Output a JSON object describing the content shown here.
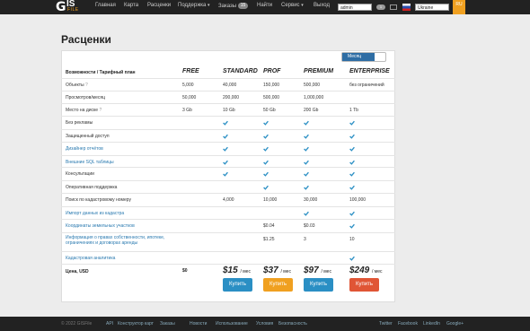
{
  "brand": {
    "logo_g": "G",
    "logo_is": "IS",
    "logo_file": "FILE"
  },
  "nav": {
    "home": "Главная",
    "map": "Карта",
    "prices": "Расценки",
    "support": "Поддержка",
    "orders": "Заказы",
    "orders_count": "15",
    "find": "Найти",
    "service": "Сервис",
    "logout": "Выход",
    "user": "admin",
    "num": "1",
    "language": "Ukraine",
    "ru": "RU"
  },
  "page": {
    "title": "Расценки",
    "period_toggle": "Месяц"
  },
  "plans": [
    {
      "name": "FREE",
      "price_small": "$0"
    },
    {
      "name": "STANDARD",
      "price": "$15",
      "per": "/ мес",
      "button": "Купить",
      "color": "#2a8fc4"
    },
    {
      "name": "PROF",
      "price": "$37",
      "per": "/ мес",
      "button": "Купить",
      "color": "#f0a020"
    },
    {
      "name": "PREMIUM",
      "price": "$97",
      "per": "/ мес",
      "button": "Купить",
      "color": "#2a8fc4"
    },
    {
      "name": "ENTERPRISE",
      "price": "$249",
      "per": "/ мес",
      "button": "Купить",
      "color": "#e05535"
    }
  ],
  "table": {
    "header_left": "Возможности / Тарифный план",
    "price_label": "Цена, USD",
    "rows": [
      {
        "label": "Объекты",
        "help": "?",
        "values": [
          "5,000",
          "40,000",
          "150,000",
          "500,000",
          "без ограничений"
        ]
      },
      {
        "label": "Просмотров/месяц",
        "values": [
          "50,000",
          "200,000",
          "500,000",
          "1,000,000",
          ""
        ]
      },
      {
        "label": "Место на диске",
        "help": "?",
        "values": [
          "3 Gb",
          "10 Gb",
          "50 Gb",
          "200 Gb",
          "1 Tb"
        ]
      },
      {
        "label": "Без рекламы",
        "checks": [
          false,
          true,
          true,
          true,
          true
        ]
      },
      {
        "label": "Защищенный доступ",
        "checks": [
          false,
          true,
          true,
          true,
          true
        ]
      },
      {
        "label": "Дизайнер отчётов",
        "link": true,
        "checks": [
          false,
          true,
          true,
          true,
          true
        ]
      },
      {
        "label": "Внешние SQL таблицы",
        "link": true,
        "checks": [
          false,
          true,
          true,
          true,
          true
        ]
      },
      {
        "label": "Консультации",
        "checks": [
          false,
          true,
          true,
          true,
          true
        ]
      },
      {
        "label": "Оперативная поддержка",
        "checks": [
          false,
          false,
          true,
          true,
          true
        ]
      },
      {
        "label": "Поиск по кадастровому номеру",
        "values": [
          "",
          "4,000",
          "10,000",
          "30,000",
          "100,000"
        ]
      },
      {
        "label": "Импорт данных из кадастра",
        "link": true,
        "checks": [
          false,
          false,
          false,
          true,
          true
        ]
      },
      {
        "label": "Координаты земельных участков",
        "link": true,
        "values": [
          "",
          "",
          "$0.04",
          "$0.03",
          ""
        ],
        "checks": [
          false,
          false,
          false,
          false,
          true
        ]
      },
      {
        "label": "Информация о правах собственности, ипотеке,",
        "label2": "ограничениях и договорах аренды",
        "link": true,
        "values": [
          "",
          "",
          "$1.25",
          "3",
          "10"
        ]
      },
      {
        "label": "Кадастровая аналитика",
        "link": true,
        "checks": [
          false,
          false,
          false,
          false,
          true
        ]
      }
    ]
  },
  "footer": {
    "copyright": "© 2022 GISFile",
    "links": [
      "API",
      "Конструктор карт",
      "Заказы",
      "Новости",
      "Использование",
      "Условия",
      "Безопасность"
    ],
    "social": [
      "Twitter",
      "Facebook",
      "LinkedIn",
      "Google+"
    ]
  },
  "colors": {
    "topbar": "#222222",
    "check": "#2a8fc4",
    "link": "#2a7ab0",
    "accent": "#f0a020"
  }
}
